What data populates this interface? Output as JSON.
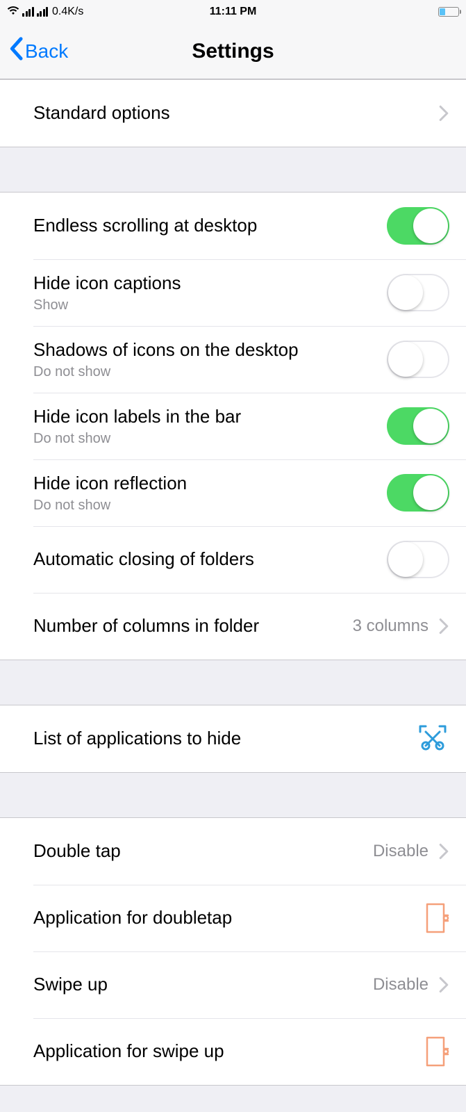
{
  "statusbar": {
    "data_rate": "0.4K/s",
    "time": "11:11 PM"
  },
  "nav": {
    "back_label": "Back",
    "title": "Settings"
  },
  "group1": {
    "standard_options": "Standard options"
  },
  "group2": {
    "endless_scrolling": {
      "title": "Endless scrolling at desktop",
      "on": true
    },
    "hide_captions": {
      "title": "Hide icon captions",
      "sub": "Show",
      "on": false
    },
    "shadows": {
      "title": "Shadows of icons on the desktop",
      "sub": "Do not show",
      "on": false
    },
    "hide_labels_bar": {
      "title": "Hide icon labels in the bar",
      "sub": "Do not show",
      "on": true
    },
    "hide_reflection": {
      "title": "Hide icon reflection",
      "sub": "Do not show",
      "on": true
    },
    "auto_close_folders": {
      "title": "Automatic closing of folders",
      "on": false
    },
    "num_columns": {
      "title": "Number of columns in folder",
      "value": "3 columns"
    }
  },
  "group3": {
    "hidden_apps": "List of applications to hide"
  },
  "group4": {
    "doubletap": {
      "title": "Double tap",
      "value": "Disable"
    },
    "app_doubletap": {
      "title": "Application for doubletap"
    },
    "swipeup": {
      "title": "Swipe up",
      "value": "Disable"
    },
    "app_swipeup": {
      "title": "Application for swipe up"
    }
  }
}
